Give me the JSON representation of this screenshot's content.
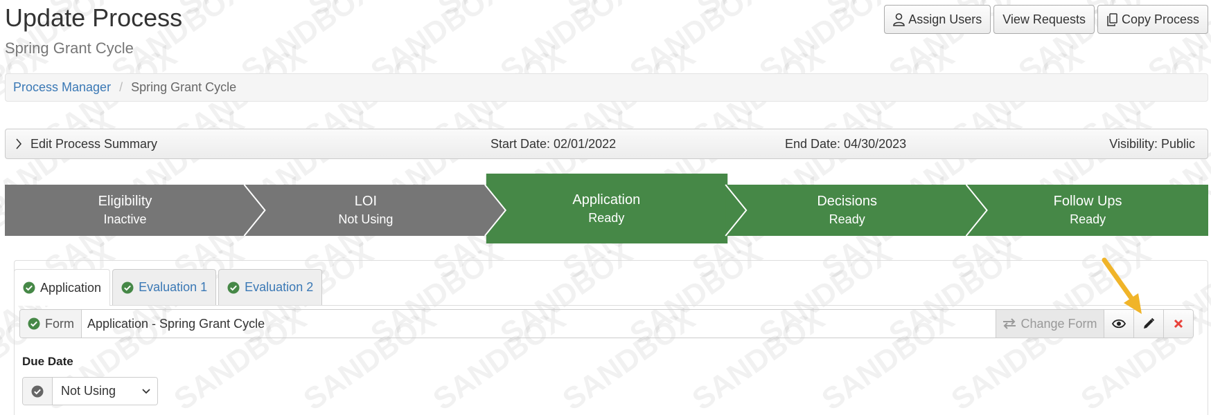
{
  "header": {
    "title": "Update Process",
    "subtitle": "Spring Grant Cycle",
    "actions": {
      "assign_users": "Assign Users",
      "view_requests": "View Requests",
      "copy_process": "Copy Process"
    }
  },
  "watermark": {
    "text": "SANDBOX"
  },
  "breadcrumb": {
    "root": "Process Manager",
    "current": "Spring Grant Cycle"
  },
  "summary": {
    "toggle_label": "Edit Process Summary",
    "start_date": "Start Date: 02/01/2022",
    "end_date": "End Date: 04/30/2023",
    "visibility": "Visibility: Public"
  },
  "stepper": {
    "colors": {
      "inactive": "#767676",
      "active": "#468847"
    },
    "steps": [
      {
        "title": "Eligibility",
        "status": "Inactive",
        "state": "inactive"
      },
      {
        "title": "LOI",
        "status": "Not Using",
        "state": "inactive"
      },
      {
        "title": "Application",
        "status": "Ready",
        "state": "selected"
      },
      {
        "title": "Decisions",
        "status": "Ready",
        "state": "active"
      },
      {
        "title": "Follow Ups",
        "status": "Ready",
        "state": "active"
      }
    ]
  },
  "tabs": [
    {
      "label": "Application",
      "active": true,
      "icon": "check-circle-icon"
    },
    {
      "label": "Evaluation 1",
      "active": false,
      "icon": "check-circle-icon"
    },
    {
      "label": "Evaluation 2",
      "active": false,
      "icon": "check-circle-icon"
    }
  ],
  "form": {
    "label": "Form",
    "name": "Application - Spring Grant Cycle",
    "change_form_label": "Change Form",
    "icons": [
      "eye-icon",
      "pencil-icon",
      "close-icon"
    ]
  },
  "due_date": {
    "label": "Due Date",
    "selected": "Not Using"
  },
  "colors": {
    "success": "#468847",
    "link": "#3a78b5",
    "danger": "#e8413a",
    "annotation_arrow": "#f0b429"
  }
}
